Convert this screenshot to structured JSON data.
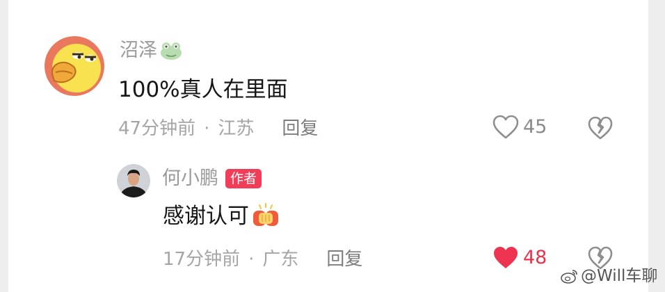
{
  "comment": {
    "avatar_icon": "yellow-duck-avatar",
    "username": "沼泽",
    "username_emoji": "frog-face-emoji",
    "text": "100%真人在里面",
    "time": "47分钟前",
    "separator": "·",
    "location": "江苏",
    "reply_label": "回复",
    "like_count": "45",
    "liked": false
  },
  "reply": {
    "avatar_icon": "author-photo-avatar",
    "username": "何小鹏",
    "badge": "作者",
    "text": "感谢认可",
    "text_emoji": "fist-bump-emoji",
    "time": "17分钟前",
    "separator": "·",
    "location": "广东",
    "reply_label": "回复",
    "like_count": "48",
    "liked": true
  },
  "watermark": {
    "text": "@Will车聊",
    "icon": "weibo-logo-icon"
  },
  "colors": {
    "accent": "#f23d58",
    "liked_heart": "#ee3350",
    "muted_text": "#a5a5a5",
    "primary_text": "#161616"
  }
}
